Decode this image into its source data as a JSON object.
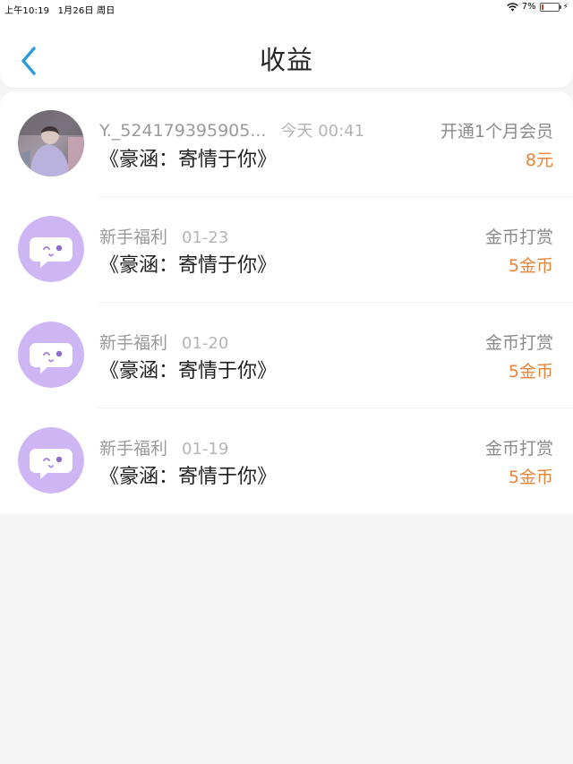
{
  "status_bar": {
    "time": "上午10:19",
    "date": "1月26日 周日",
    "battery": "7%",
    "battery_level": 0.07
  },
  "header": {
    "title": "收益"
  },
  "earnings": [
    {
      "avatar": "user-photo",
      "name": "Y._524179395905...",
      "time": "今天 00:41",
      "work": "《豪涵：寄情于你》",
      "type": "开通1个月会员",
      "amount": "8元"
    },
    {
      "avatar": "chat-bubble-icon",
      "name": "新手福利",
      "time": "01-23",
      "work": "《豪涵：寄情于你》",
      "type": "金币打赏",
      "amount": "5金币"
    },
    {
      "avatar": "chat-bubble-icon",
      "name": "新手福利",
      "time": "01-20",
      "work": "《豪涵：寄情于你》",
      "type": "金币打赏",
      "amount": "5金币"
    },
    {
      "avatar": "chat-bubble-icon",
      "name": "新手福利",
      "time": "01-19",
      "work": "《豪涵：寄情于你》",
      "type": "金币打赏",
      "amount": "5金币"
    }
  ],
  "colors": {
    "accent": "#2d9cdb",
    "amount": "#e8843a",
    "avatar_bg": "#cdb6f3",
    "page_bg": "#f6f5f6"
  }
}
